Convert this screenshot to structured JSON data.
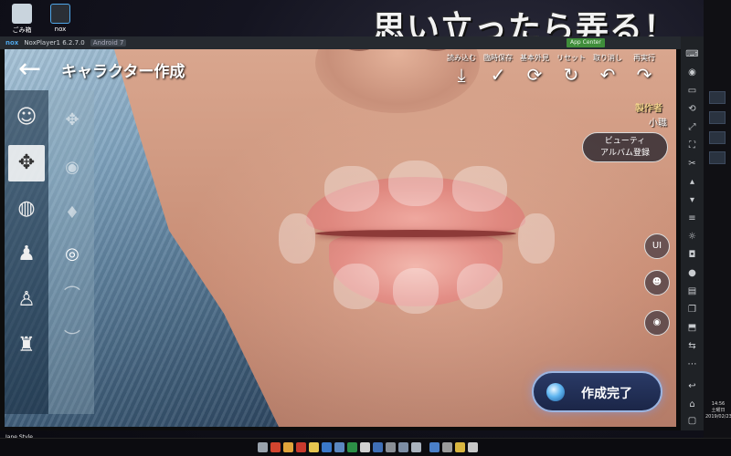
{
  "desktop": {
    "icons": [
      {
        "label": "ごみ箱"
      },
      {
        "label": "nox"
      }
    ],
    "overlay_title": "思い立ったら弄る！",
    "bottom_left_label": "Jane Style",
    "clock": {
      "time": "14:56",
      "day": "土曜日",
      "date": "2019/02/23"
    }
  },
  "emulator": {
    "brand": "nox",
    "title": "NoxPlayer1 6.2.7.0",
    "android_badge": "Android 7",
    "app_center": "App Center"
  },
  "game": {
    "screen_title": "キャラクター作成",
    "back_icon": "back-arrow-icon",
    "actions": [
      {
        "label": "読み込む",
        "icon": "download-icon",
        "glyph": "⤓"
      },
      {
        "label": "臨時保存",
        "icon": "clipboard-check-icon",
        "glyph": "✓"
      },
      {
        "label": "基本外見",
        "icon": "refresh-icon",
        "glyph": "⟳"
      },
      {
        "label": "リセット",
        "icon": "reset-icon",
        "glyph": "↻"
      },
      {
        "label": "取り消し",
        "icon": "undo-icon",
        "glyph": "↶"
      },
      {
        "label": "再実行",
        "icon": "redo-icon",
        "glyph": "↷"
      }
    ],
    "author_title": "製作者",
    "author_name": "小職",
    "beauty_button": {
      "line1": "ビューティ",
      "line2": "アルバム登録"
    },
    "left_rail": [
      {
        "name": "face-preset-icon",
        "glyph": "☺"
      },
      {
        "name": "face-move-icon",
        "glyph": "✥"
      },
      {
        "name": "mirror-icon",
        "glyph": "◍"
      },
      {
        "name": "hair-icon",
        "glyph": "♟"
      },
      {
        "name": "body-icon",
        "glyph": "♙"
      },
      {
        "name": "outfit-icon",
        "glyph": "♜"
      }
    ],
    "sub_rail": [
      {
        "name": "face-shape-icon",
        "glyph": "✥"
      },
      {
        "name": "eye-icon",
        "glyph": "◉"
      },
      {
        "name": "nose-icon",
        "glyph": "♦"
      },
      {
        "name": "lips-icon",
        "glyph": "◎"
      },
      {
        "name": "eyebrow-icon",
        "glyph": "⌒"
      },
      {
        "name": "beard-icon",
        "glyph": "︶"
      }
    ],
    "side_buttons": [
      {
        "name": "ui-toggle-button",
        "label": "UI"
      },
      {
        "name": "expression-button",
        "label": "☻"
      },
      {
        "name": "view-eye-button",
        "label": "◉"
      }
    ],
    "finish_button": "作成完了"
  },
  "colors": {
    "author_title": "#f0d08a",
    "finish_border": "#9bb4e0",
    "app_center": "#3f8d3a"
  }
}
